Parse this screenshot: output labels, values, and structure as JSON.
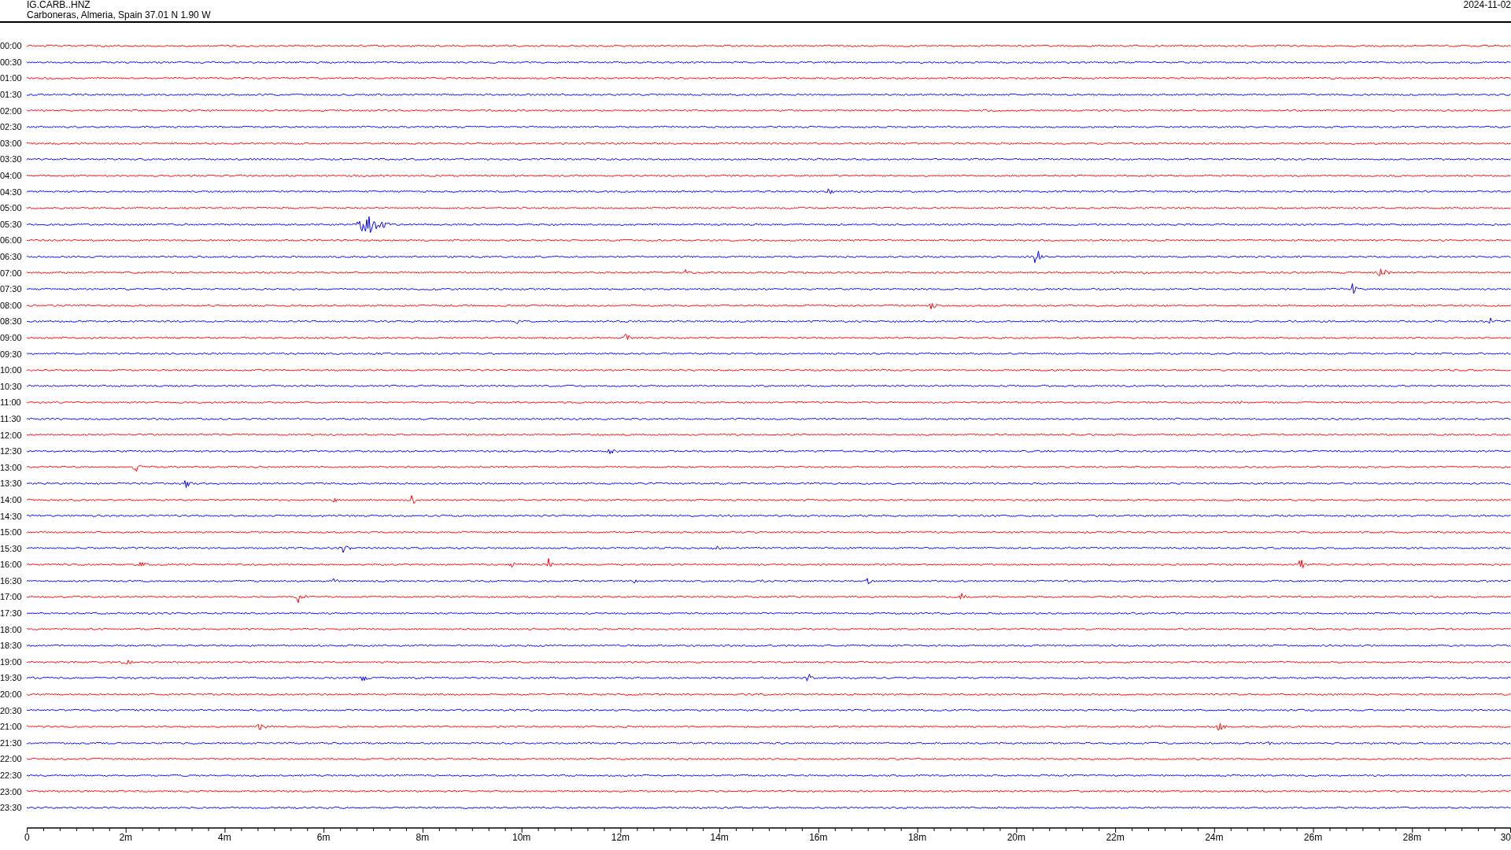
{
  "header": {
    "station": "IG.CARB..HNZ",
    "location": "Carboneras, Almeria, Spain  37.01 N 1.90 W",
    "date": "2024-11-02"
  },
  "rows": [
    {
      "time": "00:00",
      "color": "#ff0000"
    },
    {
      "time": "00:30",
      "color": "#0000ff"
    },
    {
      "time": "01:00",
      "color": "#ff0000"
    },
    {
      "time": "01:30",
      "color": "#0000ff"
    },
    {
      "time": "02:00",
      "color": "#ff0000"
    },
    {
      "time": "02:30",
      "color": "#0000ff"
    },
    {
      "time": "03:00",
      "color": "#ff0000"
    },
    {
      "time": "03:30",
      "color": "#0000ff"
    },
    {
      "time": "04:00",
      "color": "#ff0000"
    },
    {
      "time": "04:30",
      "color": "#0000ff"
    },
    {
      "time": "05:00",
      "color": "#ff0000"
    },
    {
      "time": "05:30",
      "color": "#0000ff"
    },
    {
      "time": "06:00",
      "color": "#ff0000"
    },
    {
      "time": "06:30",
      "color": "#0000ff"
    },
    {
      "time": "07:00",
      "color": "#ff0000"
    },
    {
      "time": "07:30",
      "color": "#0000ff"
    },
    {
      "time": "08:00",
      "color": "#ff0000"
    },
    {
      "time": "08:30",
      "color": "#0000ff"
    },
    {
      "time": "09:00",
      "color": "#ff0000"
    },
    {
      "time": "09:30",
      "color": "#0000ff"
    },
    {
      "time": "10:00",
      "color": "#ff0000"
    },
    {
      "time": "10:30",
      "color": "#0000ff"
    },
    {
      "time": "11:00",
      "color": "#ff0000"
    },
    {
      "time": "11:30",
      "color": "#0000ff"
    },
    {
      "time": "12:00",
      "color": "#ff0000"
    },
    {
      "time": "12:30",
      "color": "#0000ff"
    },
    {
      "time": "13:00",
      "color": "#ff0000"
    },
    {
      "time": "13:30",
      "color": "#0000ff"
    },
    {
      "time": "14:00",
      "color": "#ff0000"
    },
    {
      "time": "14:30",
      "color": "#0000ff"
    },
    {
      "time": "15:00",
      "color": "#ff0000"
    },
    {
      "time": "15:30",
      "color": "#0000ff"
    },
    {
      "time": "16:00",
      "color": "#ff0000"
    },
    {
      "time": "16:30",
      "color": "#0000ff"
    },
    {
      "time": "17:00",
      "color": "#ff0000"
    },
    {
      "time": "17:30",
      "color": "#0000ff"
    },
    {
      "time": "18:00",
      "color": "#ff0000"
    },
    {
      "time": "18:30",
      "color": "#0000ff"
    },
    {
      "time": "19:00",
      "color": "#ff0000"
    },
    {
      "time": "19:30",
      "color": "#0000ff"
    },
    {
      "time": "20:00",
      "color": "#ff0000"
    },
    {
      "time": "20:30",
      "color": "#0000ff"
    },
    {
      "time": "21:00",
      "color": "#ff0000"
    },
    {
      "time": "21:30",
      "color": "#0000ff"
    },
    {
      "time": "22:00",
      "color": "#ff0000"
    },
    {
      "time": "22:30",
      "color": "#0000ff"
    },
    {
      "time": "23:00",
      "color": "#ff0000"
    },
    {
      "time": "23:30",
      "color": "#0000ff"
    }
  ],
  "axis": {
    "tick_labels": [
      "0",
      "2m",
      "4m",
      "6m",
      "8m",
      "10m",
      "12m",
      "14m",
      "16m",
      "18m",
      "20m",
      "22m",
      "24m",
      "26m",
      "28m",
      "30"
    ]
  }
}
